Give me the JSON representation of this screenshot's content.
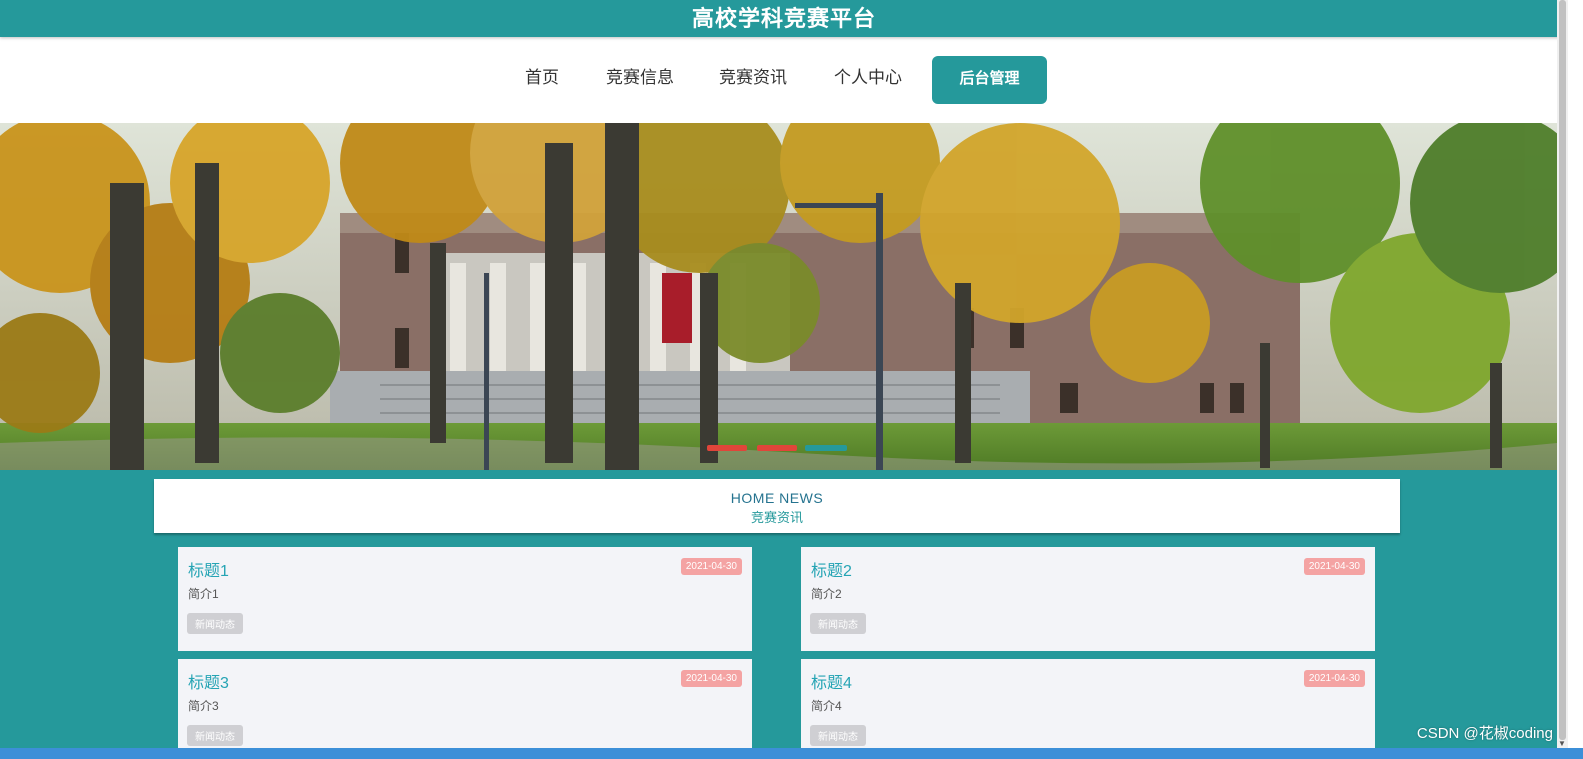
{
  "header": {
    "title": "高校学科竞赛平台"
  },
  "nav": {
    "items": [
      {
        "label": "首页"
      },
      {
        "label": "竞赛信息"
      },
      {
        "label": "竞赛资讯"
      },
      {
        "label": "个人中心"
      },
      {
        "label": "后台管理"
      }
    ]
  },
  "banner": {
    "slide_count": 3,
    "active_slide": 3
  },
  "section": {
    "title_en": "HOME NEWS",
    "title_zh": "竞赛资讯"
  },
  "news": [
    {
      "title": "标题1",
      "date": "2021-04-30",
      "desc": "简介1",
      "tag": "新闻动态"
    },
    {
      "title": "标题2",
      "date": "2021-04-30",
      "desc": "简介2",
      "tag": "新闻动态"
    },
    {
      "title": "标题3",
      "date": "2021-04-30",
      "desc": "简介3",
      "tag": "新闻动态"
    },
    {
      "title": "标题4",
      "date": "2021-04-30",
      "desc": "简介4",
      "tag": "新闻动态"
    }
  ],
  "watermark": "CSDN @花椒coding",
  "colors": {
    "primary": "#25999b",
    "card_bg": "#f3f4f8",
    "date_badge": "#f4a3a3",
    "dot_inactive": "#e0453a"
  }
}
